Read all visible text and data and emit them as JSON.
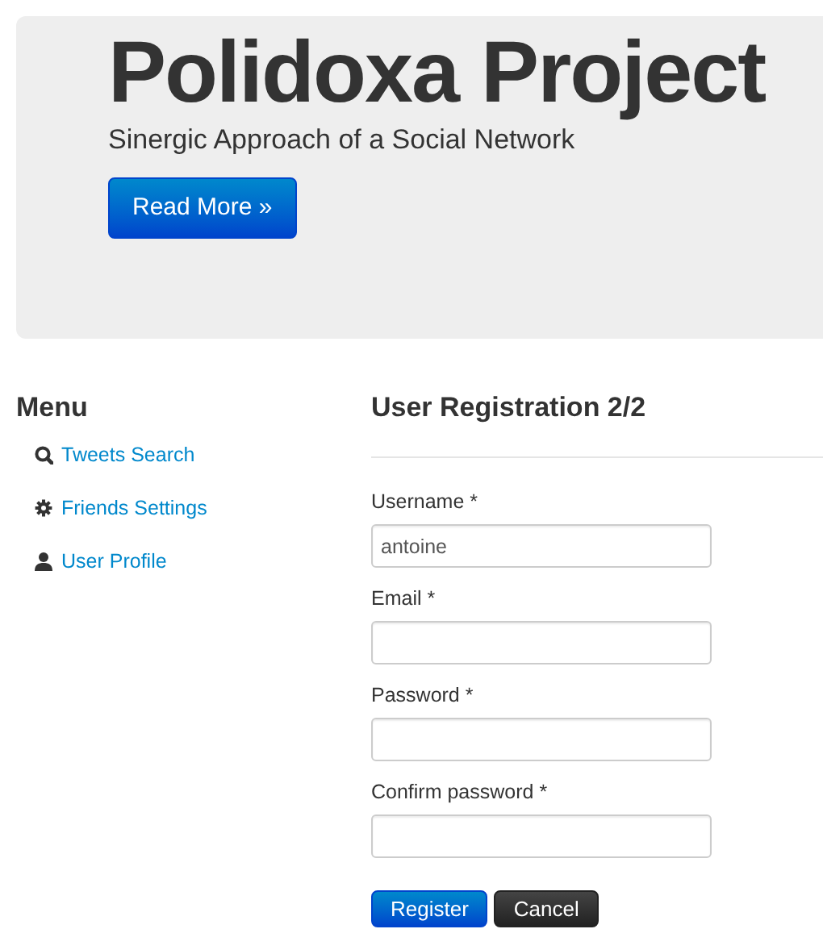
{
  "hero": {
    "title": "Polidoxa Project",
    "subtitle": "Sinergic Approach of a Social Network",
    "button": "Read More »"
  },
  "sidebar": {
    "title": "Menu",
    "items": [
      {
        "kind": "search",
        "label": "Tweets Search"
      },
      {
        "kind": "settings",
        "label": "Friends Settings"
      },
      {
        "kind": "profile",
        "label": "User Profile"
      }
    ]
  },
  "form": {
    "title": "User Registration 2/2",
    "fields": [
      {
        "label": "Username *",
        "value": "antoine"
      },
      {
        "label": "Email *"
      },
      {
        "label": "Password *"
      },
      {
        "label": "Confirm password *"
      }
    ],
    "buttons": [
      {
        "kind": "primary",
        "label": "Register"
      },
      {
        "kind": "inverse",
        "label": "Cancel"
      }
    ]
  }
}
